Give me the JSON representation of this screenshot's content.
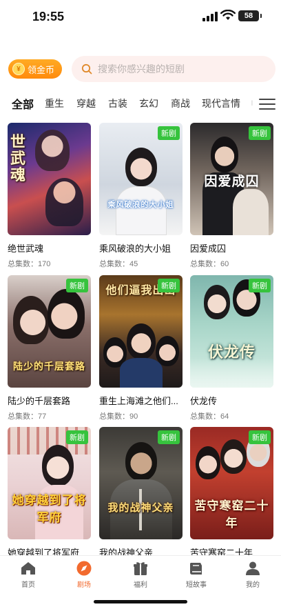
{
  "status_bar": {
    "time": "19:55",
    "battery": "58"
  },
  "header": {
    "coin_button_label": "领金币",
    "coin_icon": "coin-icon",
    "search_placeholder": "搜索你感兴趣的短剧"
  },
  "tabs": [
    "全部",
    "重生",
    "穿越",
    "古装",
    "玄幻",
    "商战",
    "现代言情",
    "ı"
  ],
  "active_tab": "全部",
  "dramas": [
    {
      "title": "绝世武魂",
      "count_label": "总集数：170",
      "badge": "",
      "poster_text": "世武魂"
    },
    {
      "title": "乘风破浪的大小姐",
      "count_label": "总集数：45",
      "badge": "新剧",
      "poster_text": "乘风破浪的大小姐"
    },
    {
      "title": "因爱成囚",
      "count_label": "总集数：60",
      "badge": "新剧",
      "poster_text": "因爱成囚"
    },
    {
      "title": "陆少的千层套路",
      "count_label": "总集数：77",
      "badge": "新剧",
      "poster_text": "陆少的千层套路"
    },
    {
      "title": "重生上海滩之他们...",
      "count_label": "总集数：90",
      "badge": "新剧",
      "poster_text": "他们逼我出山"
    },
    {
      "title": "伏龙传",
      "count_label": "总集数：64",
      "badge": "新剧",
      "poster_text": "伏龙传"
    },
    {
      "title": "她穿越到了将军府",
      "count_label": "",
      "badge": "新剧",
      "poster_text": "她穿越到了将军府"
    },
    {
      "title": "我的战神父亲",
      "count_label": "",
      "badge": "新剧",
      "poster_text": "我的战神父亲"
    },
    {
      "title": "苦守寒窑二十年",
      "count_label": "",
      "badge": "新剧",
      "poster_text": "苦守寒窑二十年"
    }
  ],
  "bottom_nav": [
    {
      "label": "首页",
      "icon": "home-icon"
    },
    {
      "label": "剧场",
      "icon": "compass-icon"
    },
    {
      "label": "福利",
      "icon": "gift-icon"
    },
    {
      "label": "短故事",
      "icon": "book-icon"
    },
    {
      "label": "我的",
      "icon": "user-icon"
    }
  ],
  "active_nav": "剧场",
  "colors": {
    "accent": "#f26a2e",
    "coin": "#ff9a18",
    "badge": "#36c33d",
    "search_bg": "#fdf0ee"
  }
}
